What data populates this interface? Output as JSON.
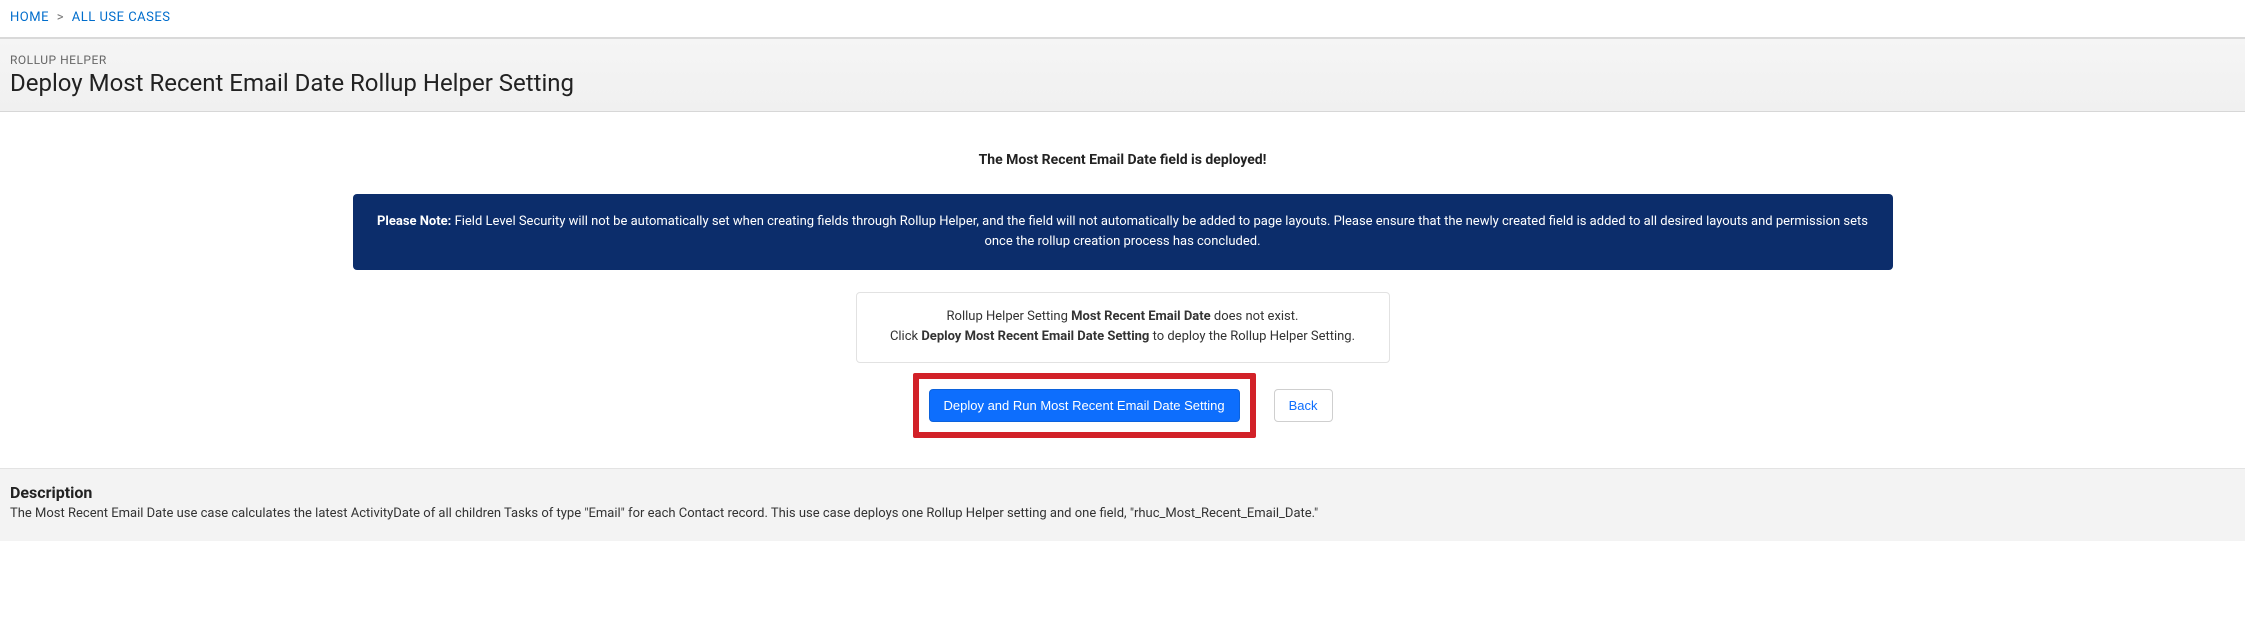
{
  "breadcrumb": {
    "home": "HOME",
    "all_use_cases": "ALL USE CASES",
    "sep": ">"
  },
  "header": {
    "subtitle": "ROLLUP HELPER",
    "title": "Deploy Most Recent Email Date Rollup Helper Setting"
  },
  "status": "The Most Recent Email Date field is deployed!",
  "note": {
    "label": "Please Note:",
    "text": " Field Level Security will not be automatically set when creating fields through Rollup Helper, and the field will not automatically be added to page layouts. Please ensure that the newly created field is added to all desired layouts and permission sets once the rollup creation process has concluded."
  },
  "info": {
    "line1_pre": "Rollup Helper Setting ",
    "line1_bold": "Most Recent Email Date",
    "line1_post": " does not exist.",
    "line2_pre": "Click ",
    "line2_bold": "Deploy Most Recent Email Date Setting",
    "line2_post": " to deploy the Rollup Helper Setting."
  },
  "actions": {
    "deploy": "Deploy and Run Most Recent Email Date Setting",
    "back": "Back"
  },
  "description": {
    "heading": "Description",
    "text": "The Most Recent Email Date use case calculates the latest ActivityDate of all children Tasks of type \"Email\" for each Contact record. This use case deploys one Rollup Helper setting and one field, \"rhuc_Most_Recent_Email_Date.\""
  }
}
